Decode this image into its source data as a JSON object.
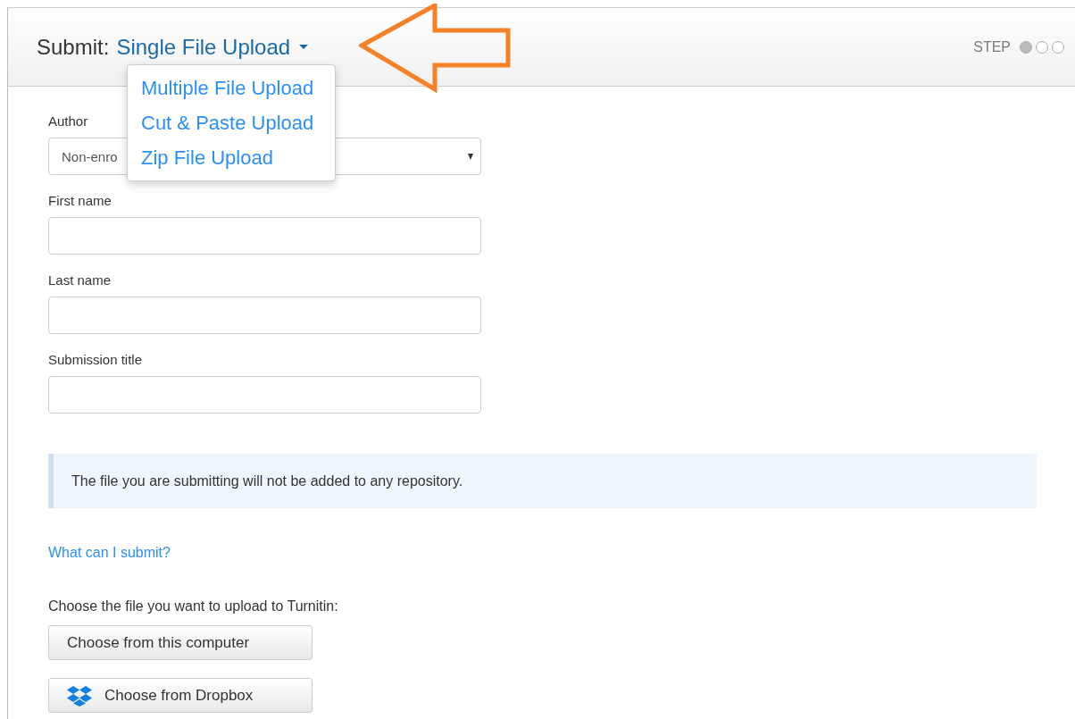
{
  "header": {
    "prefix": "Submit:",
    "title": "Single File Upload",
    "step_label": "STEP",
    "steps": [
      {
        "selected": true
      },
      {
        "selected": false
      },
      {
        "selected": false
      }
    ]
  },
  "upload_menu": {
    "items": [
      {
        "label": "Multiple File Upload"
      },
      {
        "label": "Cut & Paste Upload"
      },
      {
        "label": "Zip File Upload"
      }
    ]
  },
  "form": {
    "author": {
      "label": "Author",
      "value": "Non-enro"
    },
    "fields": [
      {
        "label": "First name"
      },
      {
        "label": "Last name"
      },
      {
        "label": "Submission title"
      }
    ]
  },
  "notice": "The file you are submitting will not be added to any repository.",
  "help_link": "What can I submit?",
  "choose_prompt": "Choose the file you want to upload to Turnitin:",
  "buttons": [
    {
      "kind": "computer",
      "label": "Choose from this computer"
    },
    {
      "kind": "dropbox",
      "label": "Choose from Dropbox"
    }
  ]
}
